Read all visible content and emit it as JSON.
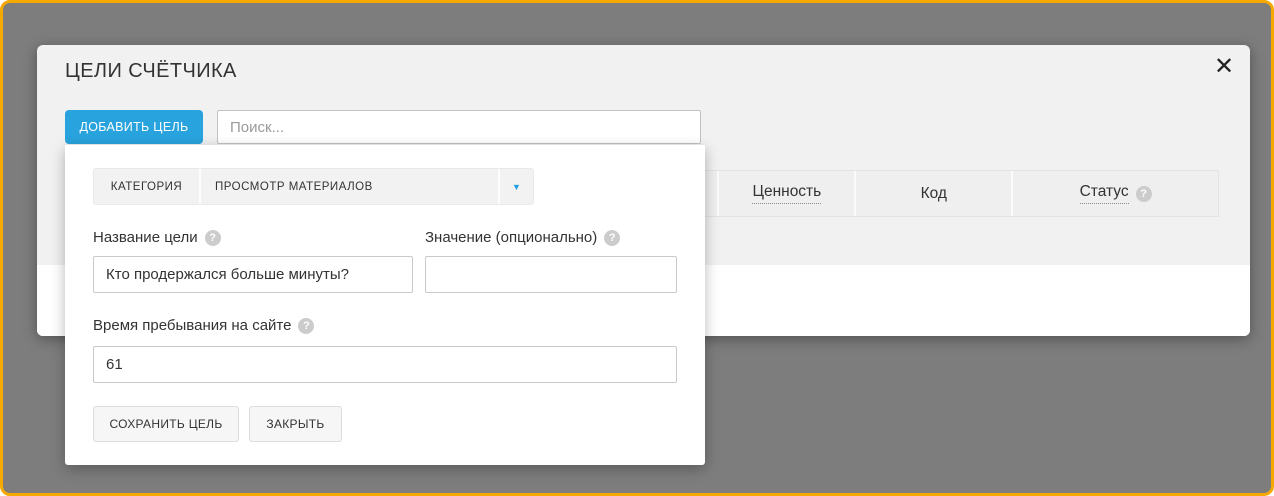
{
  "window": {
    "title": "ЦЕЛИ СЧЁТЧИКА"
  },
  "toolbar": {
    "add_goal_label": "ДОБАВИТЬ ЦЕЛЬ",
    "search_placeholder": "Поиск..."
  },
  "table": {
    "columns": [
      {
        "label": "Ценность",
        "underlined": true
      },
      {
        "label": "Код",
        "underlined": false
      },
      {
        "label": "Статус",
        "underlined": true,
        "has_help": true
      }
    ]
  },
  "goal_form": {
    "category": {
      "label": "КАТЕГОРИЯ",
      "selected": "ПРОСМОТР МАТЕРИАЛОВ"
    },
    "name": {
      "label": "Название цели",
      "value": "Кто продержался больше минуты?"
    },
    "value": {
      "label": "Значение (опционально)",
      "value": ""
    },
    "time_on_site": {
      "label": "Время пребывания на сайте",
      "value": "61"
    },
    "save_label": "СОХРАНИТЬ ЦЕЛЬ",
    "close_label": "ЗАКРЫТЬ"
  },
  "icons": {
    "close": "✕",
    "help": "?",
    "dropdown_arrow": "▼"
  },
  "colors": {
    "accent_blue": "#29a3dd",
    "frame_orange": "#f5a800",
    "backdrop_gray": "#7d7d7d",
    "modal_gray": "#f1f1f1"
  }
}
